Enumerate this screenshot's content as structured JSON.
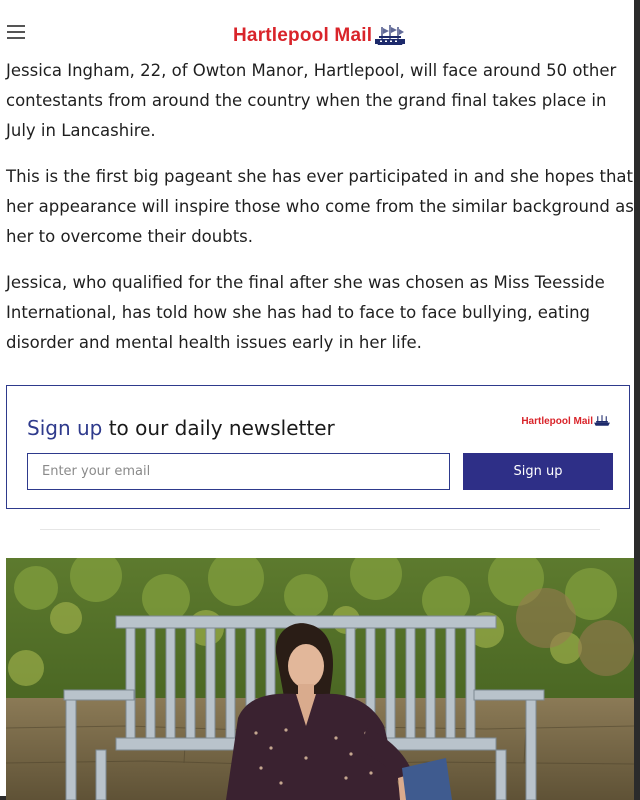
{
  "header": {
    "menu_icon": "hamburger-menu-icon",
    "brand": "Hartlepool Mail",
    "brand_color": "#d9242a"
  },
  "article": {
    "paragraphs": [
      "Jessica Ingham, 22, of Owton Manor, Hartlepool, will face around 50 other contestants from around the country when the grand final takes place in July in Lancashire.",
      "This is the first big pageant she has ever participated in and she hopes that her appearance will inspire those who come from the similar background as her to overcome their doubts.",
      "Jessica, who qualified for the final after she was chosen as Miss Teesside International, has told how she has had to face to face bullying, eating disorder and mental health issues early in her life."
    ]
  },
  "newsletter": {
    "title_accent": "Sign up",
    "title_rest": " to our daily newsletter",
    "brand": "Hartlepool Mail",
    "email_placeholder": "Enter your email",
    "button_label": "Sign up",
    "accent_color": "#2e3a8c"
  },
  "photo": {
    "subject": "woman-sitting-on-bench"
  }
}
